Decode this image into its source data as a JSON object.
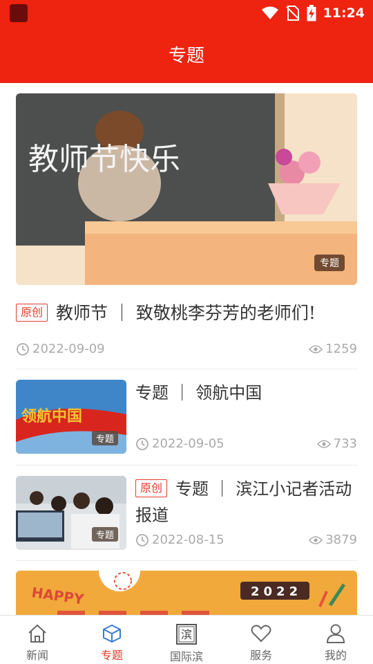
{
  "status_bar": {
    "time": "11:24"
  },
  "header": {
    "title": "专题"
  },
  "featured": {
    "image_text": "教师节快乐",
    "image_tag": "专题",
    "badge": "原创",
    "title": "教师节 ｜ 致敬桃李芬芳的老师们!",
    "date": "2022-09-09",
    "views": "1259"
  },
  "list": [
    {
      "thumb_text": "领航中国",
      "tag": "专题",
      "badge": "",
      "title": "专题 ｜ 领航中国",
      "date": "2022-09-05",
      "views": "733"
    },
    {
      "thumb_text": "",
      "tag": "专题",
      "badge": "原创",
      "title": "专题 ｜ 滨江小记者活动报道",
      "date": "2022-08-15",
      "views": "3879"
    }
  ],
  "banner": {
    "text_left": "HAPPY",
    "text_right": "2022"
  },
  "tabs": [
    {
      "label": "新闻",
      "icon": "home-icon"
    },
    {
      "label": "专题",
      "icon": "cube-icon",
      "active": true
    },
    {
      "label": "国际滨",
      "icon": "bin-logo-icon",
      "glyph": "滨"
    },
    {
      "label": "服务",
      "icon": "heart-icon"
    },
    {
      "label": "我的",
      "icon": "user-icon"
    }
  ],
  "colors": {
    "brand_red": "#ee2310",
    "active_tab": "#e53b2a",
    "badge_red": "#e53b2a",
    "meta_gray": "#aaaaaa"
  }
}
